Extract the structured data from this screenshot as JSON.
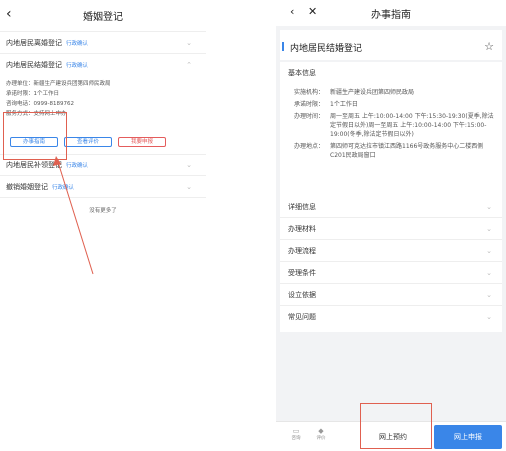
{
  "left": {
    "back_icon": "chevron-left-icon",
    "title": "婚姻登记",
    "items": [
      {
        "label": "内地居民离婚登记",
        "tag": "行政确认"
      },
      {
        "label": "内地居民结婚登记",
        "tag": "行政确认"
      },
      {
        "label": "内地居民补领登记",
        "tag": "行政确认"
      },
      {
        "label": "撤销婚姻登记",
        "tag": "行政确认"
      }
    ],
    "detail": {
      "unit": "办理单位：新疆生产建设兵团第四师民政局",
      "time": "承诺时限：1个工作日",
      "phone": "咨询电话：0999-8189762",
      "method": "服务方式：支持网上申办"
    },
    "buttons": {
      "guide": "办事指南",
      "review": "查看评价",
      "apply": "我要申报"
    },
    "no_more": "没有更多了"
  },
  "right": {
    "title": "办事指南",
    "main_title": "内地居民结婚登记",
    "basic_info_title": "基本信息",
    "basic": [
      {
        "k": "实施机构：",
        "v": "新疆生产建设兵团第四师民政局"
      },
      {
        "k": "承诺时限：",
        "v": "1个工作日"
      },
      {
        "k": "办理时间：",
        "v": "周一至周五 上午:10:00-14:00 下午:15:30-19:30(夏季,除法定节假日以外)周一至周五 上午:10:00-14:00 下午:15:00-19:00(冬季,除法定节假日以外)"
      },
      {
        "k": "办理地点：",
        "v": "第四师可克达拉市镇江西路1166号政务服务中心二楼西侧C201民政局窗口"
      }
    ],
    "sections": [
      "详细信息",
      "办理材料",
      "办理流程",
      "受理条件",
      "设立依据",
      "常见问题"
    ],
    "bottom": {
      "consult": "咨询",
      "evaluate": "评价",
      "appointment": "网上预约",
      "apply": "网上申报"
    }
  },
  "colors": {
    "accent": "#3a86e8",
    "annotation": "#e06050"
  }
}
